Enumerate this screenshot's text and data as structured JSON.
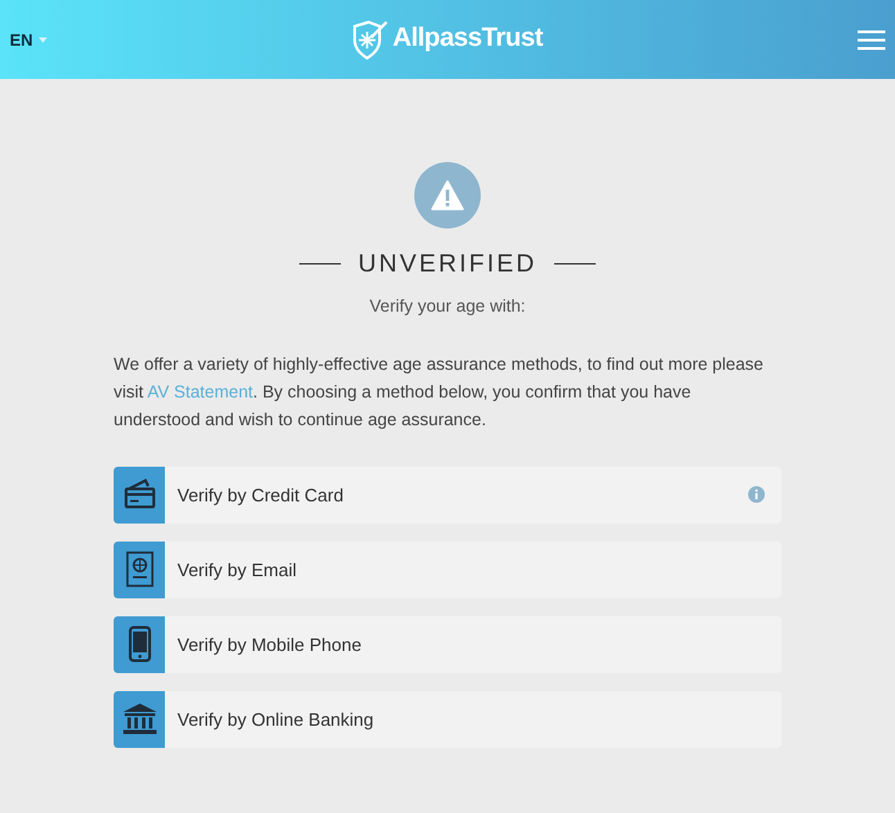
{
  "header": {
    "language": "EN",
    "logo": "AllpassTrust"
  },
  "status": {
    "title": "UNVERIFIED",
    "subtitle": "Verify your age with:"
  },
  "intro": {
    "before": "We offer a variety of highly-effective age assurance methods, to find out more please visit ",
    "link": "AV Statement",
    "after": ". By choosing a method below, you confirm that you have understood and wish to continue age assurance."
  },
  "methods": [
    {
      "kind": "card",
      "label": "Verify by Credit Card",
      "info": true
    },
    {
      "kind": "passport",
      "label": "Verify by Email",
      "info": false
    },
    {
      "kind": "phone",
      "label": "Verify by Mobile Phone",
      "info": false
    },
    {
      "kind": "bank",
      "label": "Verify by Online Banking",
      "info": false
    }
  ]
}
